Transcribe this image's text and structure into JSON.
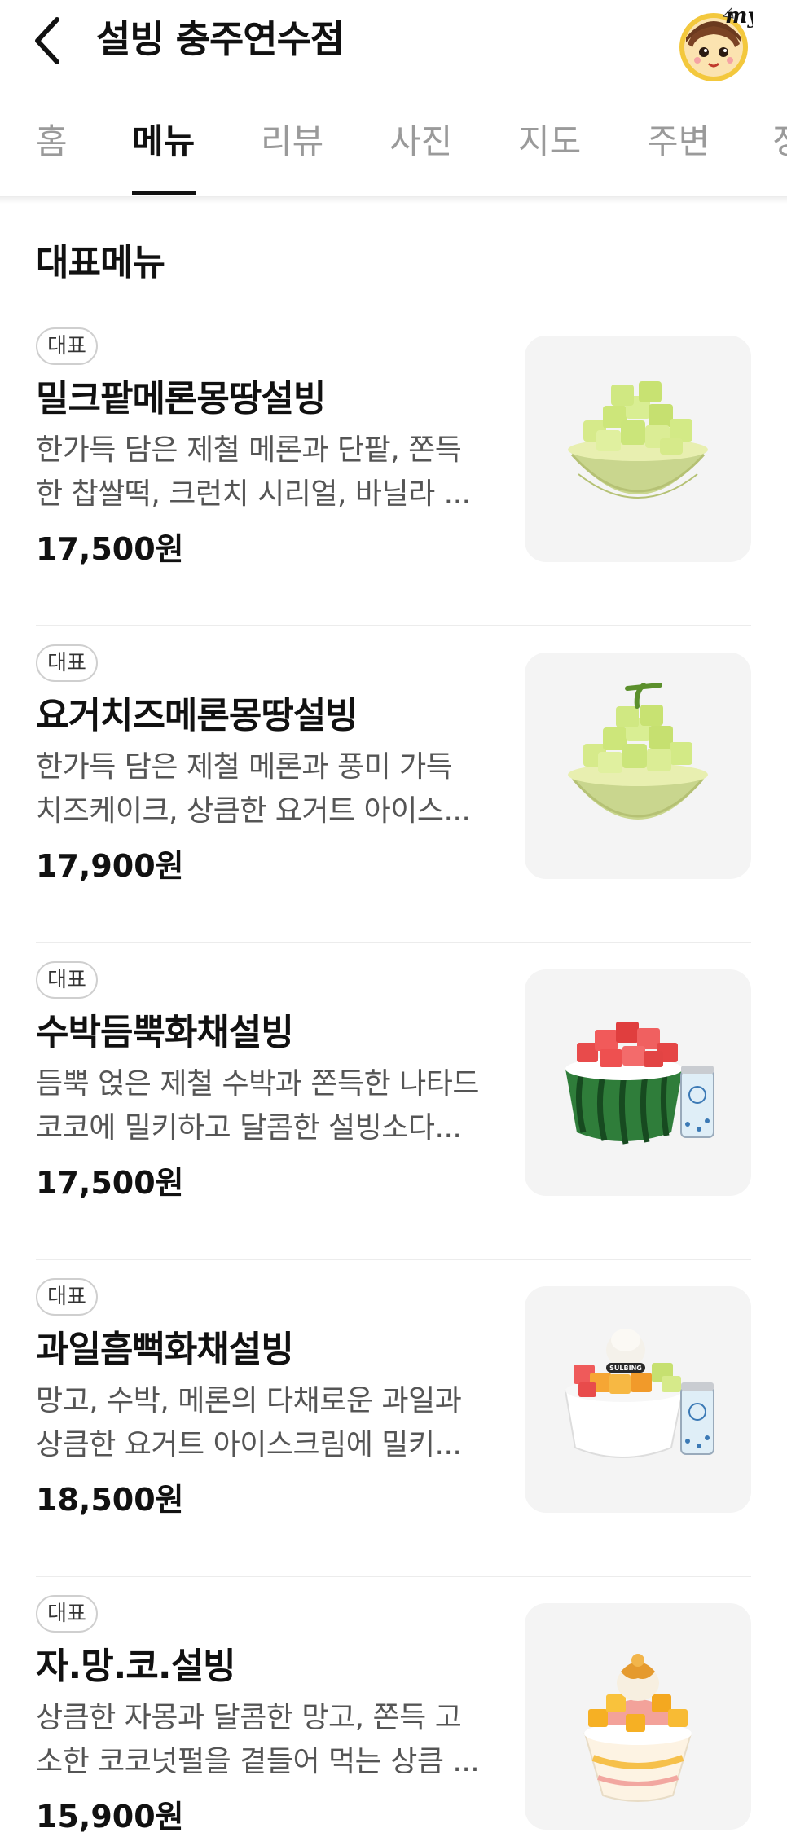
{
  "header": {
    "title": "설빙 충주연수점",
    "avatar_text": "my"
  },
  "tabs": [
    {
      "label": "홈"
    },
    {
      "label": "메뉴",
      "active": true
    },
    {
      "label": "리뷰"
    },
    {
      "label": "사진"
    },
    {
      "label": "지도"
    },
    {
      "label": "주변"
    },
    {
      "label": "정"
    }
  ],
  "section_title": "대표메뉴",
  "menu_items": [
    {
      "badge": "대표",
      "name": "밀크팥메론몽땅설빙",
      "desc_line1": "한가득 담은 제철 메론과 단팥, 쫀득",
      "desc_line2": "한 찹쌀떡, 크런치 시리얼, 바닐라 ...",
      "price": "17,500원",
      "photo_icon": "melon-bingsu-image"
    },
    {
      "badge": "대표",
      "name": "요거치즈메론몽땅설빙",
      "desc_line1": "한가득 담은 제철 메론과 풍미 가득",
      "desc_line2": "치즈케이크, 상큼한 요거트 아이스...",
      "price": "17,900원",
      "photo_icon": "melon-bingsu-stem-image"
    },
    {
      "badge": "대표",
      "name": "수박듬뿍화채설빙",
      "desc_line1": "듬뿍 얹은 제철 수박과 쫀득한 나타드",
      "desc_line2": "코코에 밀키하고 달콤한 설빙소다...",
      "price": "17,500원",
      "photo_icon": "watermelon-bingsu-image"
    },
    {
      "badge": "대표",
      "name": "과일흠뻑화채설빙",
      "desc_line1": "망고, 수박, 메론의 다채로운 과일과",
      "desc_line2": "상큼한 요거트 아이스크림에 밀키...",
      "price": "18,500원",
      "photo_icon": "fruit-bingsu-image",
      "photo_brand": "SULBING"
    },
    {
      "badge": "대표",
      "name": "자.망.코.설빙",
      "desc_line1": "상큼한 자몽과 달콤한 망고, 쫀득 고",
      "desc_line2": "소한 코코넛펄을 곁들어 먹는 상큼 ...",
      "price": "15,900원",
      "photo_icon": "grapefruit-mango-bingsu-image"
    }
  ]
}
